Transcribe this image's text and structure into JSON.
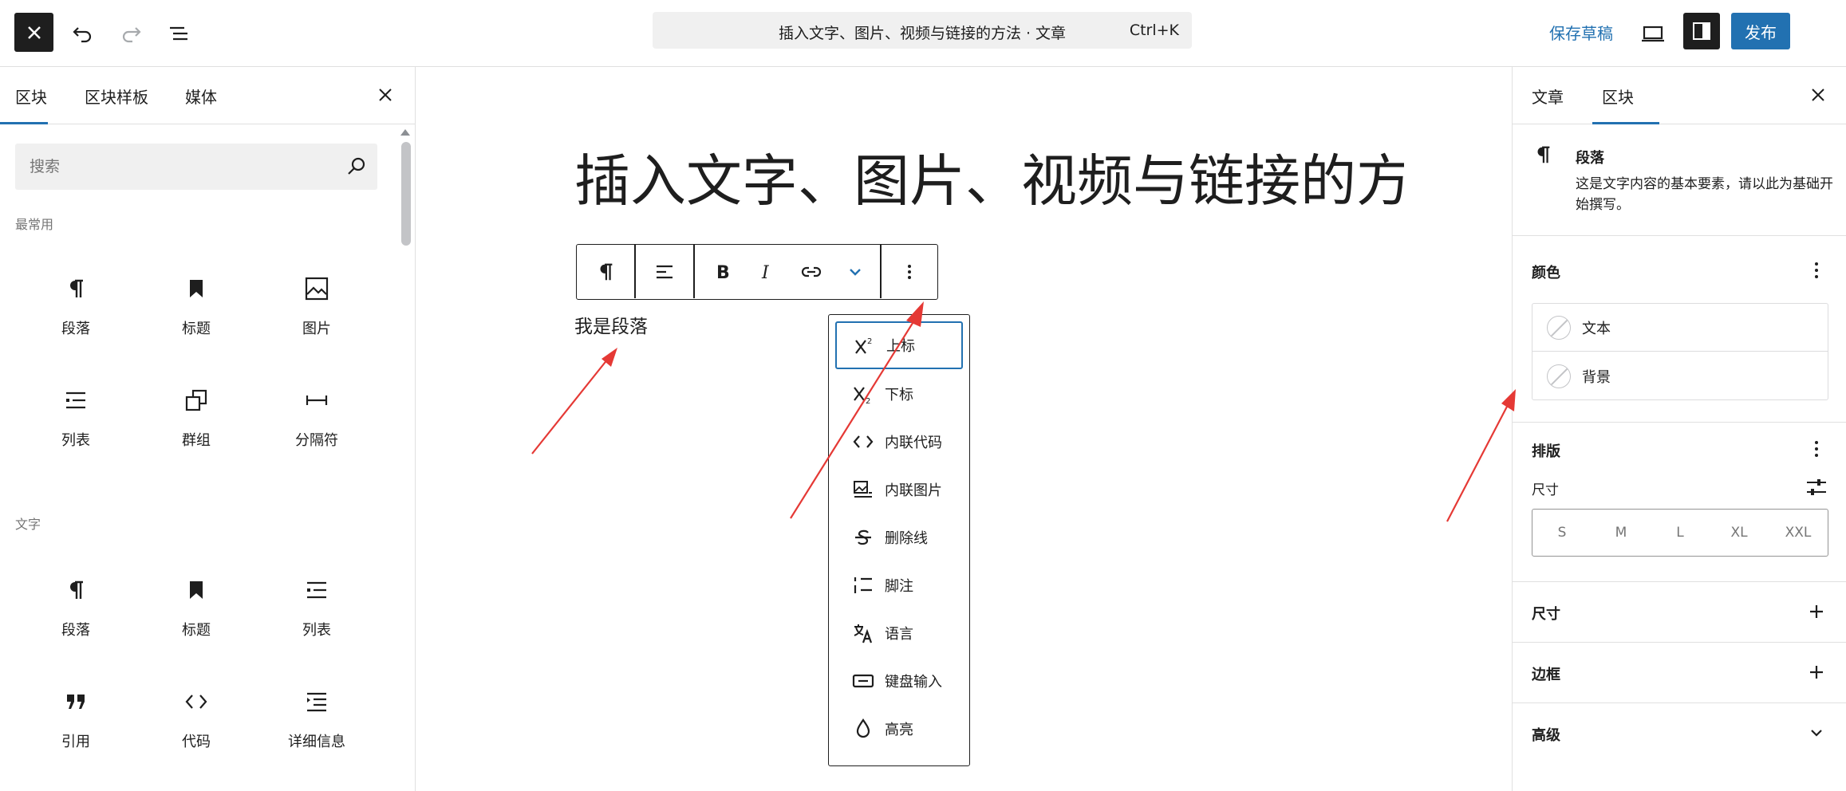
{
  "topbar": {
    "document_title": "插入文字、图片、视频与链接的方法 · 文章",
    "shortcut": "Ctrl+K",
    "save_draft": "保存草稿",
    "publish": "发布"
  },
  "inserter": {
    "tabs": [
      "区块",
      "区块样板",
      "媒体"
    ],
    "active_tab": 0,
    "search_placeholder": "搜索",
    "sections": [
      {
        "label": "最常用",
        "blocks": [
          {
            "label": "段落",
            "icon": "paragraph-icon"
          },
          {
            "label": "标题",
            "icon": "bookmark-icon"
          },
          {
            "label": "图片",
            "icon": "image-icon"
          },
          {
            "label": "列表",
            "icon": "list-icon"
          },
          {
            "label": "群组",
            "icon": "group-icon"
          },
          {
            "label": "分隔符",
            "icon": "separator-icon"
          }
        ]
      },
      {
        "label": "文字",
        "blocks": [
          {
            "label": "段落",
            "icon": "paragraph-icon"
          },
          {
            "label": "标题",
            "icon": "bookmark-icon"
          },
          {
            "label": "列表",
            "icon": "list-icon"
          },
          {
            "label": "引用",
            "icon": "quote-icon"
          },
          {
            "label": "代码",
            "icon": "code-icon"
          },
          {
            "label": "详细信息",
            "icon": "details-icon"
          }
        ]
      }
    ]
  },
  "editor": {
    "title": "插入文字、图片、视频与链接的方法",
    "paragraph": "我是段落",
    "format_menu": [
      {
        "label": "上标",
        "icon": "superscript-icon"
      },
      {
        "label": "下标",
        "icon": "subscript-icon"
      },
      {
        "label": "内联代码",
        "icon": "code-icon"
      },
      {
        "label": "内联图片",
        "icon": "inline-image-icon"
      },
      {
        "label": "删除线",
        "icon": "strikethrough-icon"
      },
      {
        "label": "脚注",
        "icon": "footnote-icon"
      },
      {
        "label": "语言",
        "icon": "language-icon"
      },
      {
        "label": "键盘输入",
        "icon": "keyboard-icon"
      },
      {
        "label": "高亮",
        "icon": "highlight-icon"
      }
    ],
    "focused_format_item": 0
  },
  "settings": {
    "tabs": [
      "文章",
      "区块"
    ],
    "active_tab": 1,
    "block": {
      "name": "段落",
      "description": "这是文字内容的基本要素，请以此为基础开始撰写。"
    },
    "color": {
      "title": "颜色",
      "items": [
        "文本",
        "背景"
      ]
    },
    "typography": {
      "title": "排版",
      "size_label": "尺寸",
      "sizes": [
        "S",
        "M",
        "L",
        "XL",
        "XXL"
      ]
    },
    "collapsed_panels": [
      {
        "title": "尺寸",
        "icon": "plus-icon"
      },
      {
        "title": "边框",
        "icon": "plus-icon"
      },
      {
        "title": "高级",
        "icon": "chevron-down-icon"
      }
    ]
  },
  "colors": {
    "accent": "#2271b1",
    "dark": "#1e1e1e",
    "annotation_arrow": "#e53935"
  }
}
